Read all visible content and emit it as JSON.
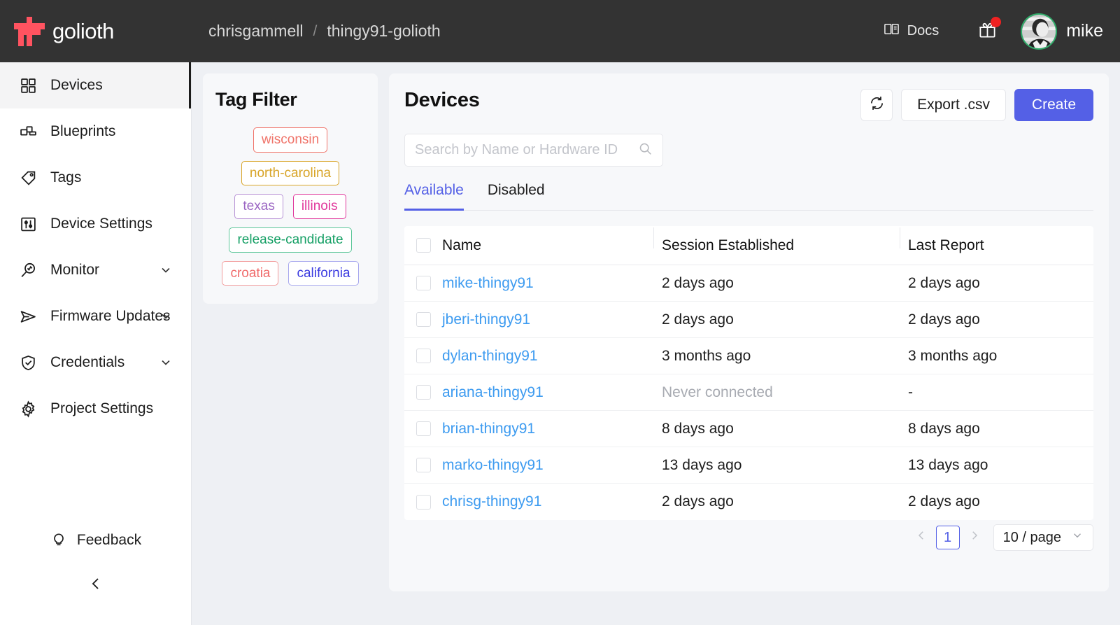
{
  "brand": {
    "name": "golioth",
    "logo_icon": "golioth-logo-icon",
    "logo_color": "#ff5360"
  },
  "header": {
    "breadcrumb": {
      "org": "chrisgammell",
      "separator": "/",
      "project": "thingy91-golioth"
    },
    "docs_label": "Docs",
    "docs_icon": "book-icon",
    "gift_icon": "gift-icon",
    "notification_color": "#ef2222",
    "avatar_label": "avatar",
    "avatar_ring_color": "#2fae6a",
    "user_name": "mike"
  },
  "sidebar": {
    "items": [
      {
        "label": "Devices",
        "icon": "grid-icon",
        "active": true,
        "expandable": false
      },
      {
        "label": "Blueprints",
        "icon": "blueprints-icon",
        "active": false,
        "expandable": false
      },
      {
        "label": "Tags",
        "icon": "tag-icon",
        "active": false,
        "expandable": false
      },
      {
        "label": "Device Settings",
        "icon": "sliders-icon",
        "active": false,
        "expandable": false
      },
      {
        "label": "Monitor",
        "icon": "magnifier-pulse-icon",
        "active": false,
        "expandable": true
      },
      {
        "label": "Firmware Updates",
        "icon": "send-icon",
        "active": false,
        "expandable": true
      },
      {
        "label": "Credentials",
        "icon": "shield-check-icon",
        "active": false,
        "expandable": true
      },
      {
        "label": "Project Settings",
        "icon": "gear-icon",
        "active": false,
        "expandable": false
      }
    ],
    "feedback_label": "Feedback",
    "feedback_icon": "lightbulb-icon",
    "collapse_icon": "chevron-left-icon"
  },
  "tag_filter": {
    "title": "Tag Filter",
    "rows": [
      [
        {
          "label": "wisconsin",
          "color": "#f0746a"
        }
      ],
      [
        {
          "label": "north-carolina",
          "color": "#d8a427"
        }
      ],
      [
        {
          "label": "texas",
          "color": "#9b66c3"
        },
        {
          "label": "illinois",
          "color": "#e0379b"
        }
      ],
      [
        {
          "label": "release-candidate",
          "color": "#17a066"
        }
      ],
      [
        {
          "label": "croatia",
          "color": "#f06a6a"
        },
        {
          "label": "california",
          "color": "#3b3be0"
        }
      ]
    ]
  },
  "devices_panel": {
    "title": "Devices",
    "refresh_icon": "refresh-icon",
    "export_label": "Export .csv",
    "create_label": "Create",
    "create_color": "#5460e6",
    "search": {
      "placeholder": "Search by Name or Hardware ID",
      "value": "",
      "icon": "search-icon"
    },
    "tabs": [
      {
        "label": "Available",
        "active": true
      },
      {
        "label": "Disabled",
        "active": false
      }
    ],
    "table": {
      "columns": [
        "Name",
        "Session Established",
        "Last Report"
      ],
      "rows": [
        {
          "name": "mike-thingy91",
          "session": "2 days ago",
          "last_report": "2 days ago",
          "session_muted": false
        },
        {
          "name": "jberi-thingy91",
          "session": "2 days ago",
          "last_report": "2 days ago",
          "session_muted": false
        },
        {
          "name": "dylan-thingy91",
          "session": "3 months ago",
          "last_report": "3 months ago",
          "session_muted": false
        },
        {
          "name": "ariana-thingy91",
          "session": "Never connected",
          "last_report": "-",
          "session_muted": true
        },
        {
          "name": "brian-thingy91",
          "session": "8 days ago",
          "last_report": "8 days ago",
          "session_muted": false
        },
        {
          "name": "marko-thingy91",
          "session": "13 days ago",
          "last_report": "13 days ago",
          "session_muted": false
        },
        {
          "name": "chrisg-thingy91",
          "session": "2 days ago",
          "last_report": "2 days ago",
          "session_muted": false
        }
      ]
    },
    "pagination": {
      "prev_icon": "chevron-left-icon",
      "next_icon": "chevron-right-icon",
      "current_page": "1",
      "page_size": "10 / page",
      "page_size_icon": "chevron-down-icon"
    }
  }
}
